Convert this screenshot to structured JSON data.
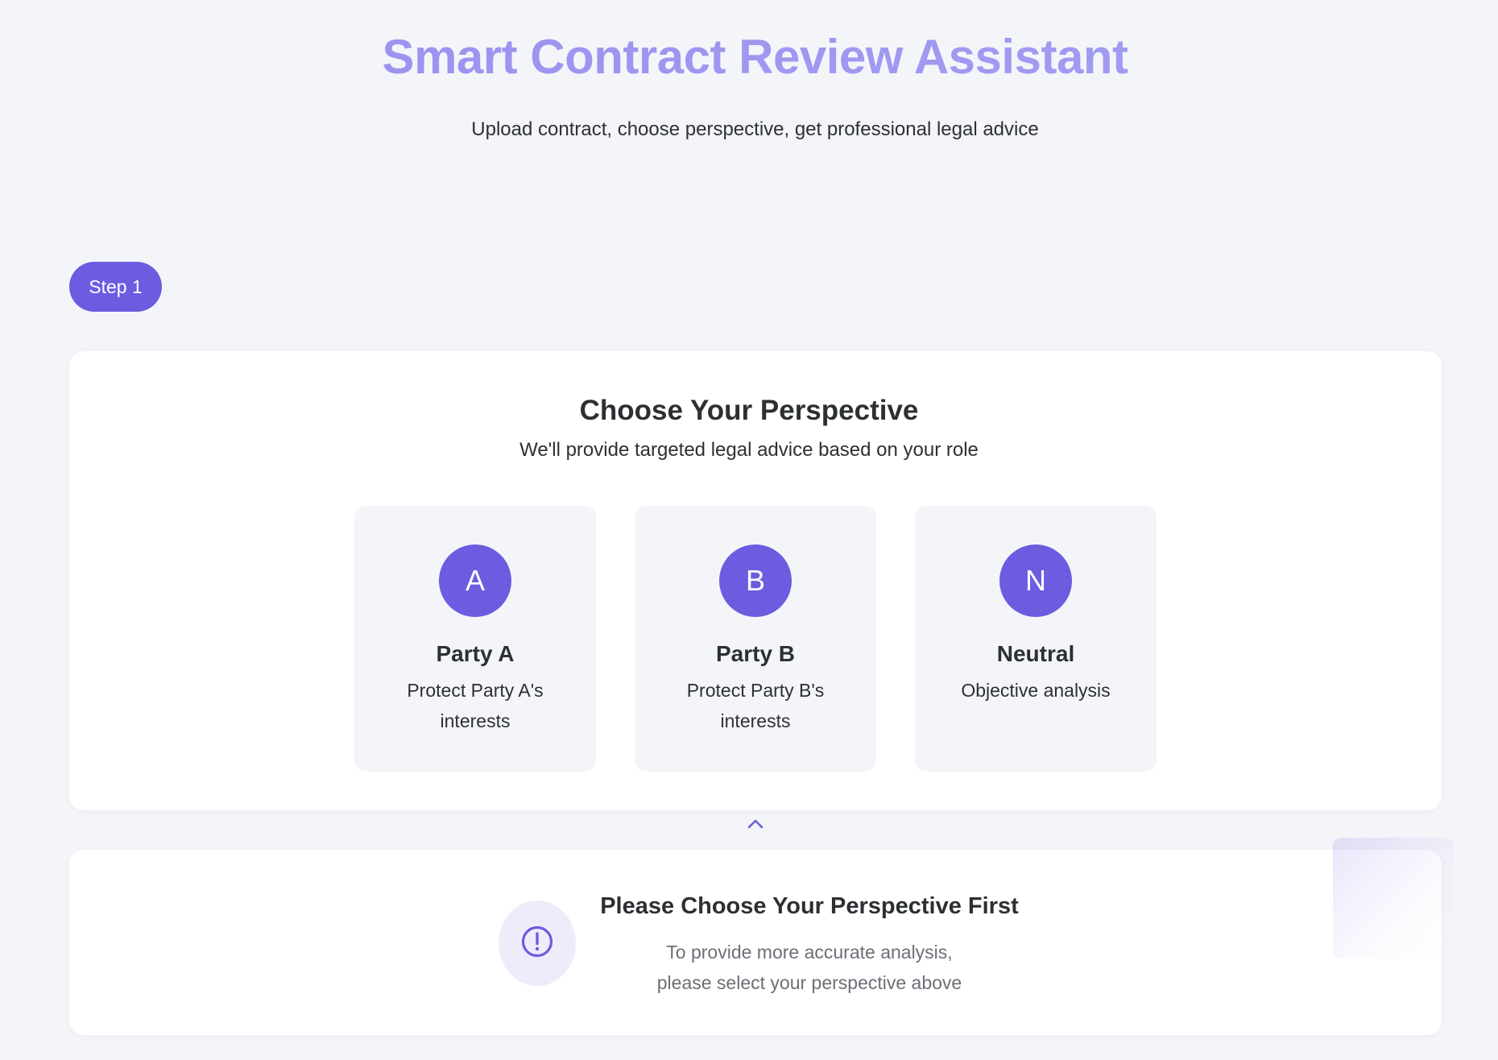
{
  "header": {
    "title": "Smart Contract Review Assistant",
    "subtitle": "Upload contract, choose perspective, get professional legal advice"
  },
  "step": {
    "label": "Step 1"
  },
  "perspective": {
    "title": "Choose Your Perspective",
    "subtitle": "We'll provide targeted legal advice based on your role",
    "options": [
      {
        "letter": "A",
        "name": "Party A",
        "description": "Protect Party A's interests"
      },
      {
        "letter": "B",
        "name": "Party B",
        "description": "Protect Party B's interests"
      },
      {
        "letter": "N",
        "name": "Neutral",
        "description": "Objective analysis"
      }
    ]
  },
  "notice": {
    "title": "Please Choose Your Perspective First",
    "text_line1": "To provide more accurate analysis,",
    "text_line2": "please select your perspective above",
    "icon": "exclamation-circle-icon"
  },
  "colors": {
    "accent": "#6b5ce0",
    "title_gradient_start": "#9a90ee",
    "title_gradient_end": "#a29ff3",
    "background": "#f4f5f9",
    "notice_icon_bg": "#eeecfb"
  }
}
